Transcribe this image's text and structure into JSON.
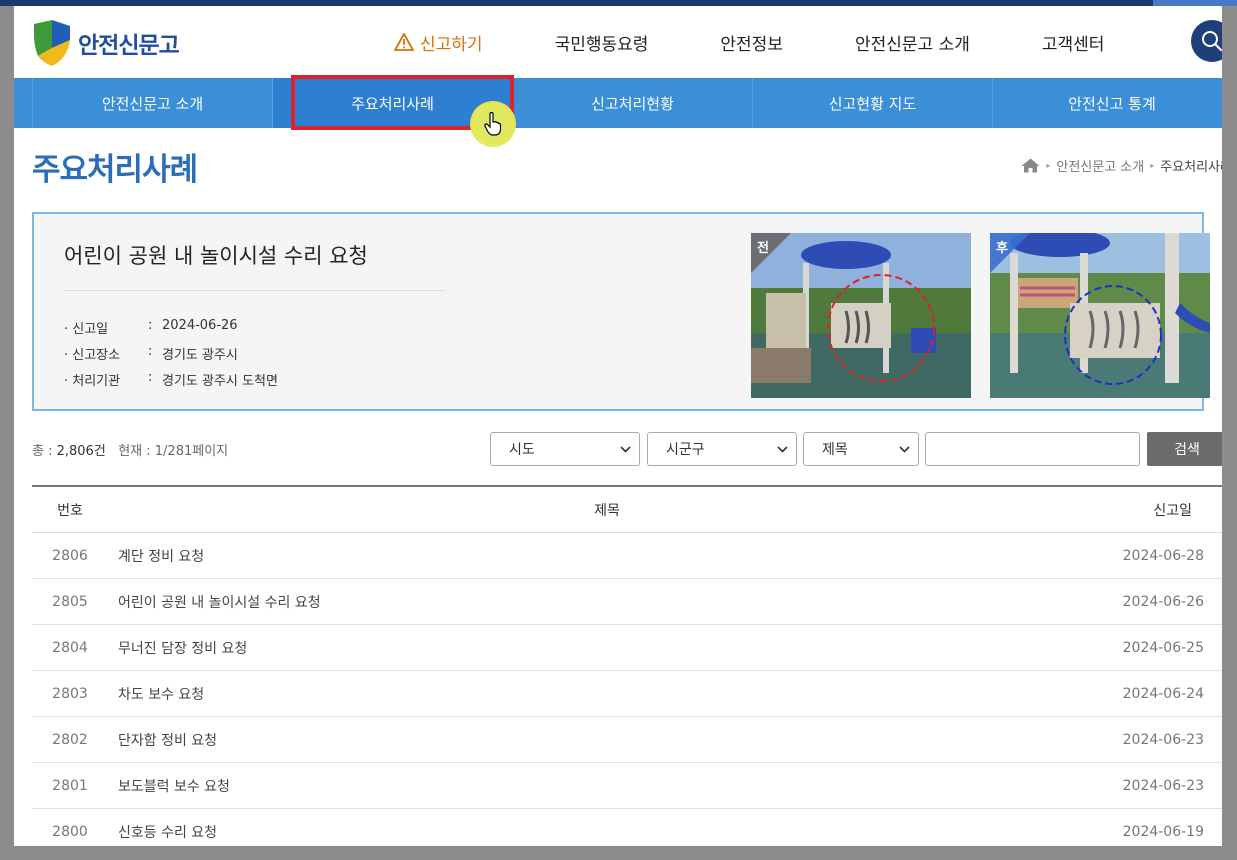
{
  "header": {
    "logo_text": "안전신문고",
    "nav": [
      {
        "label": "신고하기",
        "active": true
      },
      {
        "label": "국민행동요령"
      },
      {
        "label": "안전정보"
      },
      {
        "label": "안전신문고 소개"
      },
      {
        "label": "고객센터"
      }
    ]
  },
  "subnav": [
    {
      "label": "안전신문고 소개"
    },
    {
      "label": "주요처리사례",
      "active": true
    },
    {
      "label": "신고처리현황"
    },
    {
      "label": "신고현황 지도"
    },
    {
      "label": "안전신고 통계"
    }
  ],
  "page": {
    "title": "주요처리사례",
    "breadcrumb": [
      "안전신문고 소개",
      "주요처리사례"
    ]
  },
  "featured": {
    "title": "어린이 공원 내 놀이시설 수리 요청",
    "info": [
      {
        "key": "· 신고일",
        "value": "2024-06-26"
      },
      {
        "key": "· 신고장소",
        "value": "경기도 광주시"
      },
      {
        "key": "· 처리기관",
        "value": "경기도 광주시 도척면"
      }
    ],
    "before_label": "전",
    "after_label": "후"
  },
  "list": {
    "total_prefix": "총 : ",
    "total": "2,806건",
    "page_info": "현재 : 1/281페이지",
    "filters": {
      "sido": "시도",
      "sigungu": "시군구",
      "field": "제목"
    },
    "search_button": "검색",
    "columns": {
      "no": "번호",
      "title": "제목",
      "date": "신고일"
    },
    "rows": [
      {
        "no": "2806",
        "title": "계단 정비 요청",
        "date": "2024-06-28"
      },
      {
        "no": "2805",
        "title": "어린이 공원 내 놀이시설 수리 요청",
        "date": "2024-06-26"
      },
      {
        "no": "2804",
        "title": "무너진 담장 정비 요청",
        "date": "2024-06-25"
      },
      {
        "no": "2803",
        "title": "차도 보수 요청",
        "date": "2024-06-24"
      },
      {
        "no": "2802",
        "title": "단자함 정비 요청",
        "date": "2024-06-23"
      },
      {
        "no": "2801",
        "title": "보도블럭 보수 요청",
        "date": "2024-06-23"
      },
      {
        "no": "2800",
        "title": "신호등 수리 요청",
        "date": "2024-06-19"
      }
    ]
  },
  "colors": {
    "brand_blue": "#1f4e9c",
    "subnav_blue": "#3a8fd6",
    "accent_orange": "#d9700b",
    "highlight_red": "#e0202a"
  }
}
